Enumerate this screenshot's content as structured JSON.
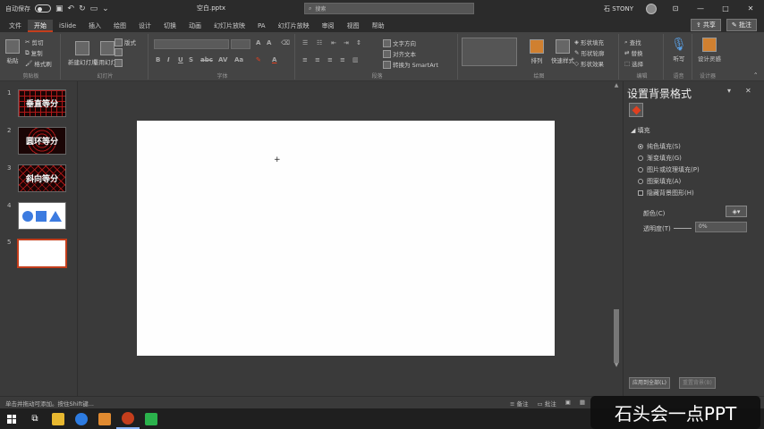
{
  "titlebar": {
    "autosave": "自动保存",
    "filename": "空白.pptx",
    "search_placeholder": "搜索",
    "user": "石 STONY",
    "window_controls": [
      "ribbon-display-icon",
      "minimize-icon",
      "restore-icon",
      "close-icon"
    ]
  },
  "tabs": {
    "items": [
      "文件",
      "开始",
      "iSlide",
      "插入",
      "绘图",
      "设计",
      "切换",
      "动画",
      "幻灯片放映",
      "PA",
      "幻灯片放映",
      "审阅",
      "视图",
      "帮助"
    ],
    "active_index": 1,
    "share": "共享",
    "comments": "批注"
  },
  "ribbon": {
    "paste": "粘贴",
    "cut": "剪切",
    "copy": "复制",
    "format_painter": "格式刷",
    "clipboard": "剪贴板",
    "new_slide": "新建幻灯片",
    "reuse_slide": "重用幻灯片",
    "layout": "版式",
    "slides": "幻灯片",
    "font": "字体",
    "paragraph": "段落",
    "text_direction": "文字方向",
    "align_text": "对齐文本",
    "smartart": "转换为 SmartArt",
    "arrange": "排列",
    "quick_styles": "快速样式",
    "shape_fill": "形状填充",
    "shape_outline": "形状轮廓",
    "shape_effects": "形状效果",
    "drawing": "绘图",
    "find": "查找",
    "replace": "替换",
    "select": "选择",
    "editing": "编辑",
    "dictate": "听写",
    "voice": "语音",
    "design_ideas": "设计灵感",
    "designer": "设计器"
  },
  "slides": [
    {
      "num": "1",
      "title": "垂直等分",
      "style": "grid"
    },
    {
      "num": "2",
      "title": "圆环等分",
      "style": "rings"
    },
    {
      "num": "3",
      "title": "斜向等分",
      "style": "diag"
    },
    {
      "num": "4",
      "title": "",
      "style": "shapes"
    },
    {
      "num": "5",
      "title": "",
      "style": "blank"
    }
  ],
  "pane": {
    "title": "设置背景格式",
    "section": "填充",
    "options": [
      "纯色填充(S)",
      "渐变填充(G)",
      "图片或纹理填充(P)",
      "图案填充(A)"
    ],
    "hide_graphics": "隐藏背景图形(H)",
    "color_label": "颜色(C)",
    "transparency_label": "透明度(T)",
    "transparency_value": "0%",
    "apply_all": "应用到全部(L)",
    "reset": "重置背景(B)"
  },
  "statusbar": {
    "left": "单击并拖动可添加。按住Shift键...",
    "notes": "备注",
    "comments": "批注"
  },
  "watermark": "石头会一点PPT",
  "colors": {
    "accent": "#c43e1c",
    "thumb_red": "#b01818",
    "shape_blue": "#3c7be0"
  }
}
